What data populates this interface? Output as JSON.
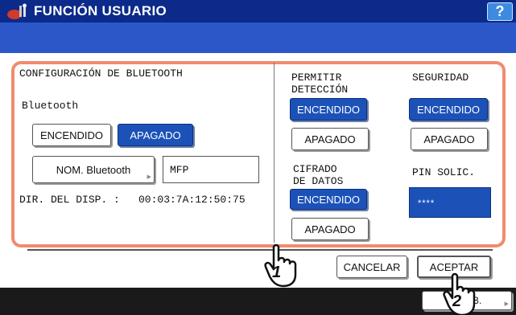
{
  "header": {
    "title": "FUNCIÓN USUARIO",
    "help_label": "?"
  },
  "panel": {
    "section_title": "CONFIGURACIÓN DE BLUETOOTH",
    "bluetooth_label": "Bluetooth",
    "bluetooth_on_label": "ENCENDIDO",
    "bluetooth_off_label": "APAGADO",
    "bluetooth_selected": "APAGADO",
    "name_button_label": "NOM. Bluetooth",
    "name_value": "MFP",
    "address_label": "DIR. DEL DISP. :",
    "address_value": "00:03:7A:12:50:75",
    "discovery": {
      "label_line1": "PERMITIR",
      "label_line2": "DETECCIÓN",
      "on_label": "ENCENDIDO",
      "off_label": "APAGADO",
      "selected": "ENCENDIDO"
    },
    "security": {
      "label": "SEGURIDAD",
      "on_label": "ENCENDIDO",
      "off_label": "APAGADO",
      "selected": "ENCENDIDO"
    },
    "encryption": {
      "label_line1": "CIFRADO",
      "label_line2": "DE DATOS",
      "on_label": "ENCENDIDO",
      "off_label": "APAGADO",
      "selected": "ENCENDIDO"
    },
    "pin": {
      "label": "PIN SOLIC.",
      "value": "****"
    }
  },
  "actions": {
    "cancel_label": "CANCELAR",
    "accept_label": "ACEPTAR",
    "job_status_label": "E   AB."
  },
  "callouts": {
    "step1": "1",
    "step2": "2"
  },
  "colors": {
    "title_bar": "#0b2a8a",
    "blue_bar": "#2b57c8",
    "selected_button": "#1c52b8",
    "panel_border": "#f08c6e",
    "help_button": "#3c8be0"
  }
}
